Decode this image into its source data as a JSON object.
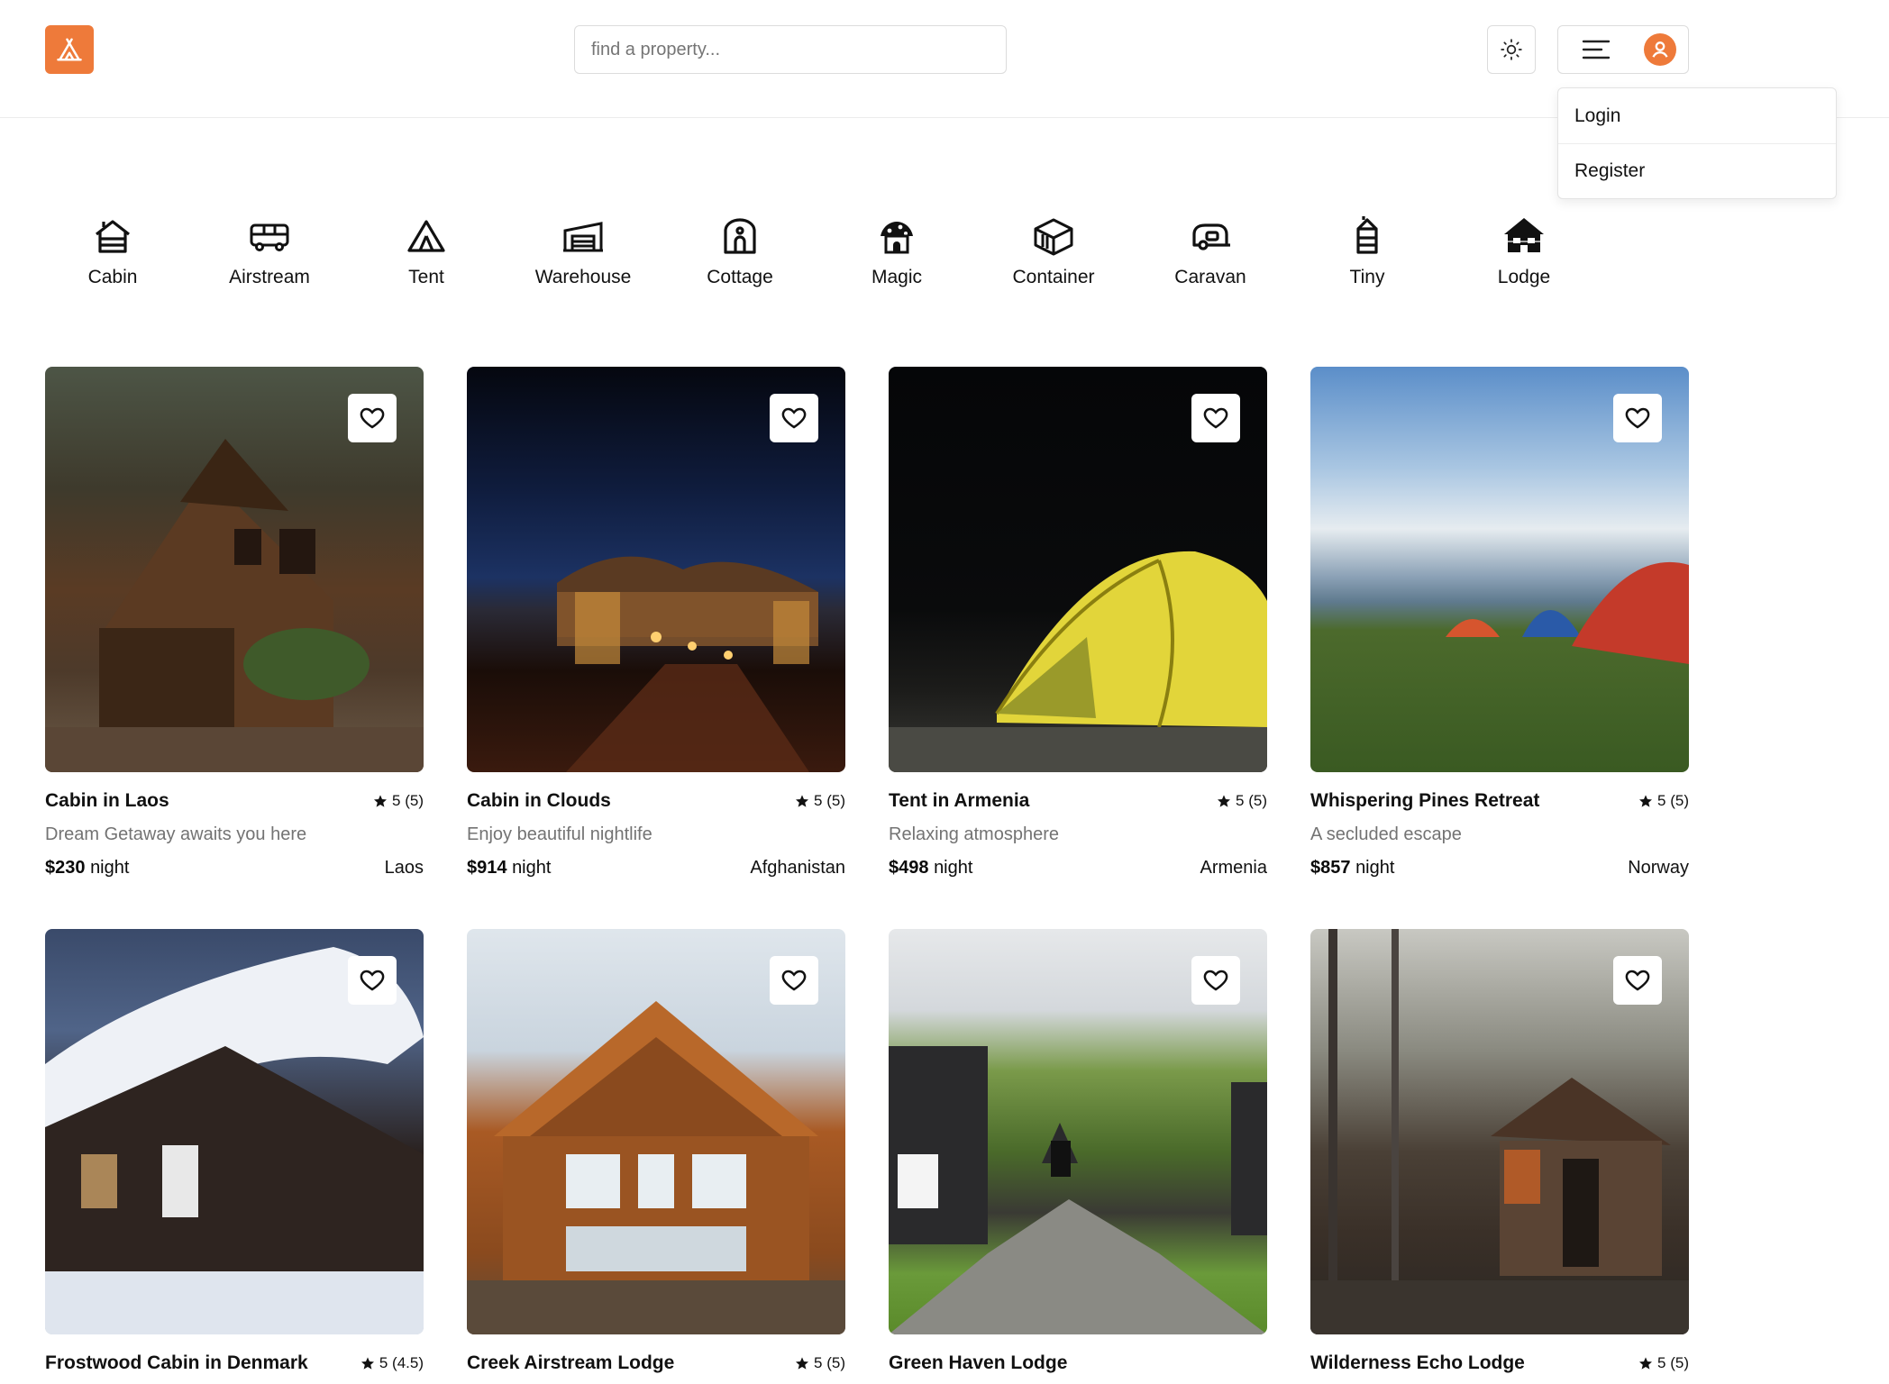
{
  "header": {
    "search_placeholder": "find a property...",
    "accent_color": "#ee7a3a",
    "logo_icon": "tent-logo-icon",
    "theme_icon": "sun-icon",
    "menu_icon": "hamburger-icon",
    "avatar_icon": "user-avatar-icon"
  },
  "dropdown": {
    "items": [
      {
        "label": "Login"
      },
      {
        "label": "Register"
      }
    ]
  },
  "categories": [
    {
      "label": "Cabin",
      "icon": "cabin-icon"
    },
    {
      "label": "Airstream",
      "icon": "airstream-icon"
    },
    {
      "label": "Tent",
      "icon": "tent-icon"
    },
    {
      "label": "Warehouse",
      "icon": "warehouse-icon"
    },
    {
      "label": "Cottage",
      "icon": "cottage-icon"
    },
    {
      "label": "Magic",
      "icon": "magic-icon"
    },
    {
      "label": "Container",
      "icon": "container-icon"
    },
    {
      "label": "Caravan",
      "icon": "caravan-icon"
    },
    {
      "label": "Tiny",
      "icon": "tiny-icon"
    },
    {
      "label": "Lodge",
      "icon": "lodge-icon"
    }
  ],
  "listings": [
    {
      "title": "Cabin in Laos",
      "rating": "5 (5)",
      "tagline": "Dream Getaway awaits you here",
      "price": "$230",
      "price_unit": "night",
      "country": "Laos"
    },
    {
      "title": "Cabin in Clouds",
      "rating": "5 (5)",
      "tagline": "Enjoy beautiful nightlife",
      "price": "$914",
      "price_unit": "night",
      "country": "Afghanistan"
    },
    {
      "title": "Tent in Armenia",
      "rating": "5 (5)",
      "tagline": "Relaxing atmosphere",
      "price": "$498",
      "price_unit": "night",
      "country": "Armenia"
    },
    {
      "title": "Whispering Pines Retreat",
      "rating": "5 (5)",
      "tagline": "A secluded escape",
      "price": "$857",
      "price_unit": "night",
      "country": "Norway"
    },
    {
      "title": "Frostwood Cabin in Denmark",
      "rating": "5 (4.5)"
    },
    {
      "title": "Creek Airstream Lodge",
      "rating": "5 (5)"
    },
    {
      "title": "Green Haven Lodge",
      "rating": ""
    },
    {
      "title": "Wilderness Echo Lodge",
      "rating": "5 (5)"
    }
  ]
}
